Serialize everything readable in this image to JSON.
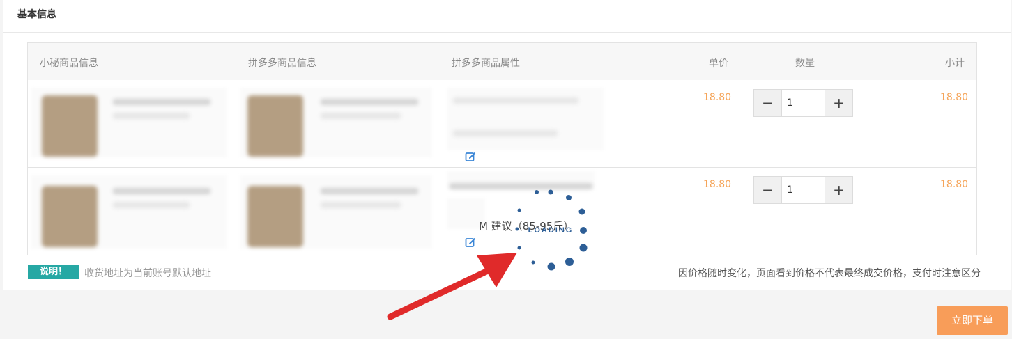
{
  "section": {
    "title": "基本信息"
  },
  "table": {
    "headers": {
      "local_product": "小秘商品信息",
      "pdd_product": "拼多多商品信息",
      "pdd_attributes": "拼多多商品属性",
      "unit_price": "单价",
      "quantity": "数量",
      "subtotal": "小计"
    },
    "rows": [
      {
        "unit_price": "18.80",
        "quantity": "1",
        "subtotal": "18.80",
        "attribute_text": ""
      },
      {
        "unit_price": "18.80",
        "quantity": "1",
        "subtotal": "18.80",
        "attribute_text": "M 建议（85-95斤）"
      }
    ]
  },
  "notice": {
    "badge": "说明！",
    "text": "收货地址为当前账号默认地址",
    "price_notice": "因价格随时变化，页面看到价格不代表最终成交价格，支付时注意区分"
  },
  "actions": {
    "submit_label": "立即下单"
  },
  "loading": {
    "text": "LOADING"
  },
  "colors": {
    "price": "#f5a55a",
    "badge": "#26a8a4",
    "submit": "#f89d59",
    "spinner": "#2d5e96",
    "arrow": "#e02a2a",
    "edit_icon": "#3b86d6"
  },
  "icons": {
    "minus": "−",
    "plus": "+",
    "edit": "edit-icon",
    "arrow": "arrow-annotation"
  }
}
